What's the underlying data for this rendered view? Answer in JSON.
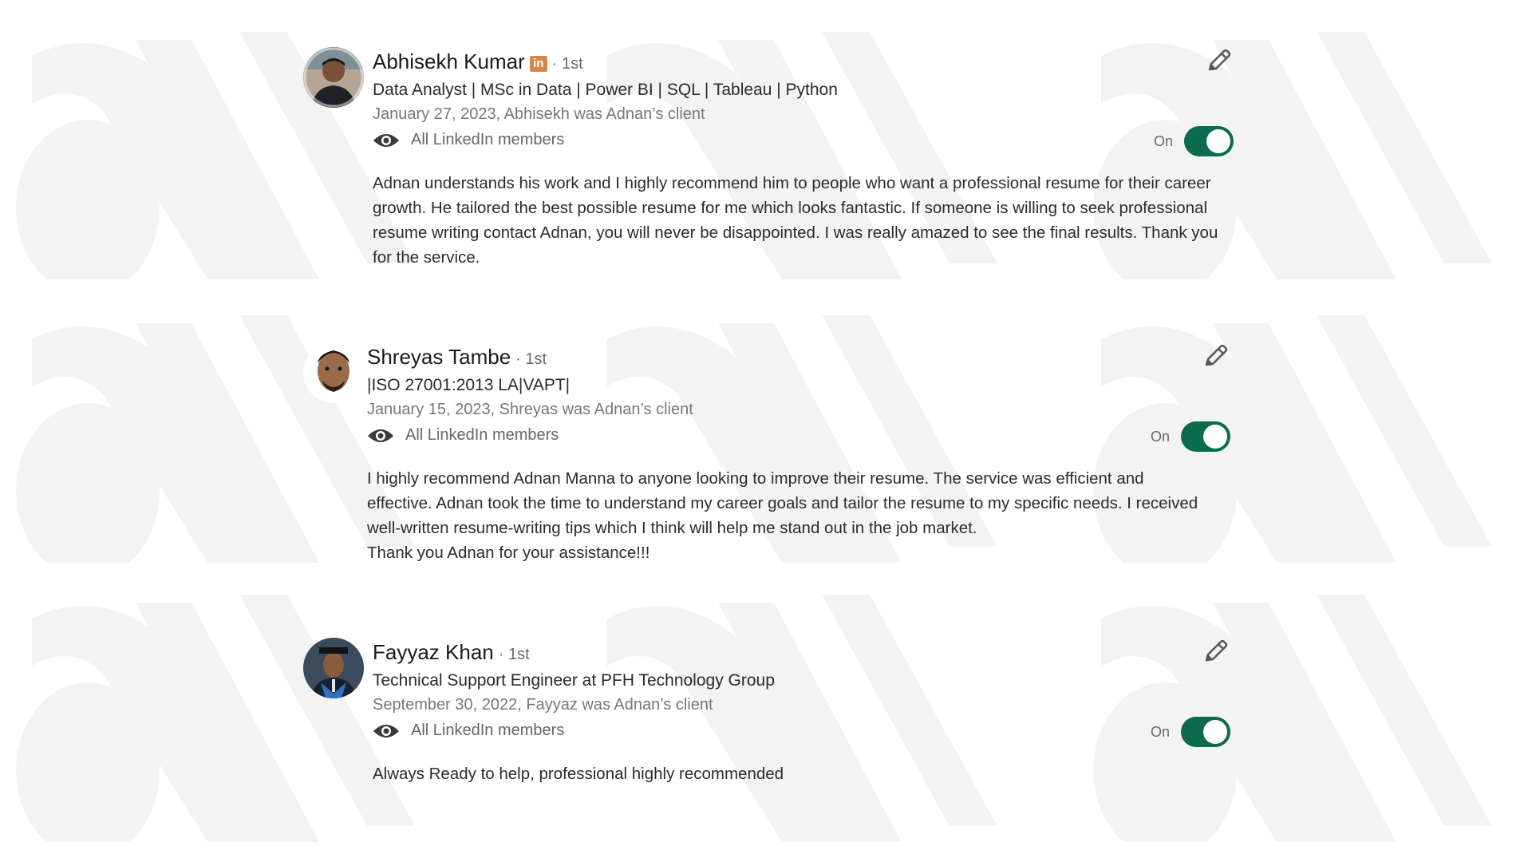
{
  "recommendations": [
    {
      "name": "Abhisekh Kumar",
      "has_linkedin_badge": true,
      "linkedin_badge_text": "in",
      "degree": "· 1st",
      "headline": "Data Analyst | MSc in Data | Power BI | SQL | Tableau | Python",
      "dateline": "January 27, 2023, Abhisekh was Adnan’s client",
      "visibility": "All LinkedIn members",
      "toggle_label": "On",
      "toggle_on": true,
      "text": [
        "Adnan understands his work and I highly recommend him to people who want a professional resume for their career growth. He tailored the best possible resume for me which looks fantastic. If someone is willing to seek professional resume writing contact Adnan, you will never be disappointed. I was really amazed to see the final results. Thank you for the service."
      ]
    },
    {
      "name": "Shreyas Tambe",
      "has_linkedin_badge": false,
      "degree": "· 1st",
      "headline": "|ISO 27001:2013 LA|VAPT|",
      "dateline": "January 15, 2023, Shreyas was Adnan’s client",
      "visibility": "All LinkedIn members",
      "toggle_label": "On",
      "toggle_on": true,
      "text": [
        "I highly recommend Adnan Manna to anyone looking to improve their resume. The service was efficient and effective. Adnan took the time to understand my career goals and tailor the resume to my specific needs. I received well-written resume-writing tips which I think will help me stand out in the job market.",
        "Thank you Adnan for your assistance!!!"
      ]
    },
    {
      "name": "Fayyaz Khan",
      "has_linkedin_badge": false,
      "degree": "· 1st",
      "headline": "Technical Support Engineer at PFH Technology Group",
      "dateline": "September 30, 2022, Fayyaz was Adnan’s client",
      "visibility": "All LinkedIn members",
      "toggle_label": "On",
      "toggle_on": true,
      "text": [
        "Always Ready to help, professional highly recommended"
      ]
    }
  ],
  "colors": {
    "toggle_on": "#0b6b4f",
    "linkedin_badge": "#d8874a",
    "watermark": "#f4f4f4"
  },
  "icons": [
    "eye-icon",
    "pencil-icon"
  ]
}
